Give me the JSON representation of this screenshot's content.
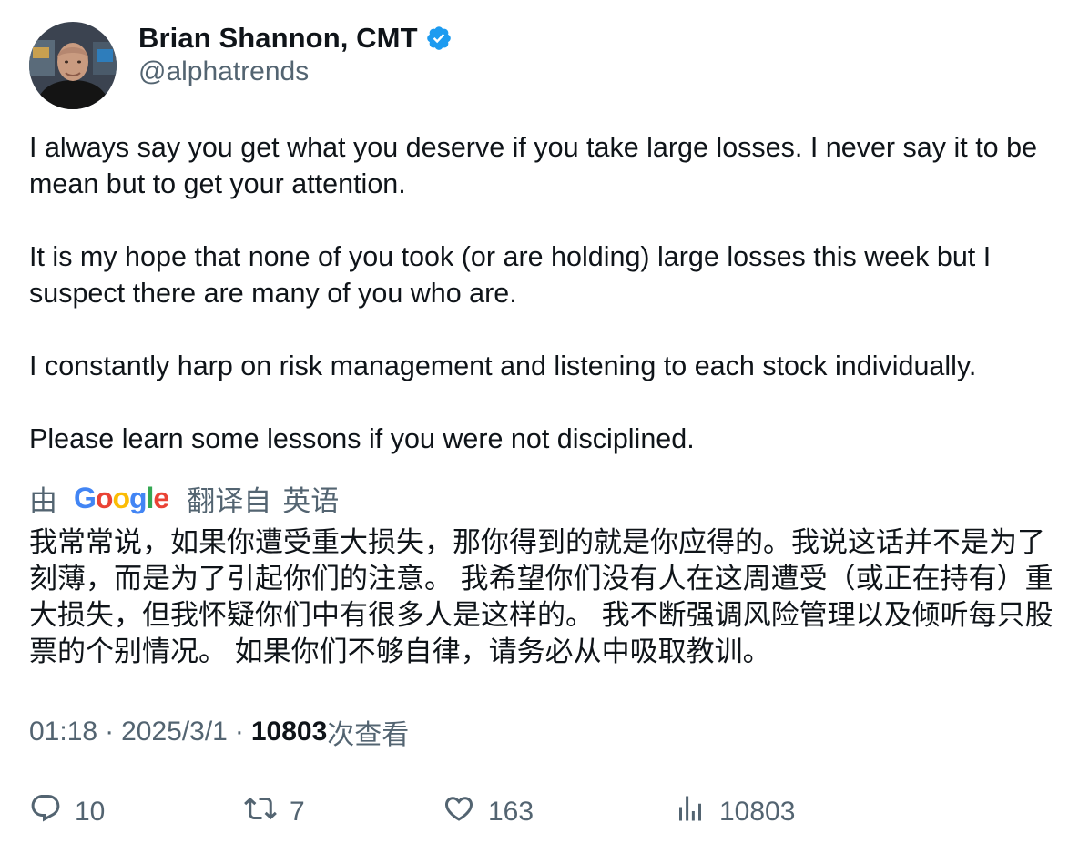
{
  "author": {
    "display_name": "Brian Shannon, CMT",
    "handle": "@alphatrends",
    "verified": true,
    "verified_color": "#1d9bf0"
  },
  "tweet": {
    "paragraphs": [
      "I always say you get what you deserve if you take large losses.  I never say it to be mean but to get your attention.",
      "It is my hope that none of you took (or are holding) large losses this week but I suspect there are many of you who are.",
      "I constantly harp on risk management and listening to each stock individually.",
      "Please learn some lessons if you were not disciplined."
    ]
  },
  "translation": {
    "by_label": "由",
    "provider": "Google",
    "translated_from": "翻译自",
    "language": "英语",
    "text": "我常常说，如果你遭受重大损失，那你得到的就是你应得的。我说这话并不是为了刻薄，而是为了引起你们的注意。 我希望你们没有人在这周遭受（或正在持有）重大损失，但我怀疑你们中有很多人是这样的。 我不断强调风险管理以及倾听每只股票的个别情况。 如果你们不够自律，请务必从中吸取教训。"
  },
  "meta": {
    "time": "01:18",
    "separator": "·",
    "date": "2025/3/1",
    "views_count": "10803",
    "views_label": "次查看"
  },
  "actions": {
    "replies": "10",
    "retweets": "7",
    "likes": "163",
    "views": "10803"
  },
  "colors": {
    "text_primary": "#0f1419",
    "text_secondary": "#536471",
    "google_blue": "#4285f4",
    "google_red": "#ea4335",
    "google_yellow": "#fbbc05",
    "google_green": "#34a853"
  },
  "icons": {
    "reply": "reply-icon",
    "retweet": "retweet-icon",
    "like": "heart-icon",
    "views": "analytics-icon",
    "verified": "verified-badge-icon"
  }
}
